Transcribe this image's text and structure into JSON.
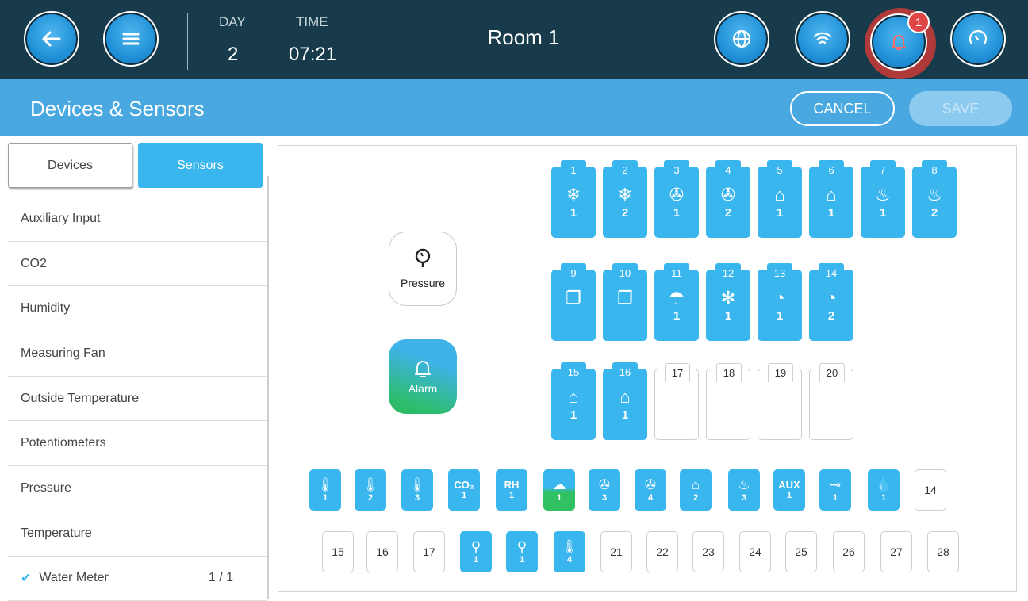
{
  "header": {
    "day_label": "DAY",
    "day_value": "2",
    "time_label": "TIME",
    "time_value": "07:21",
    "room": "Room 1",
    "alarm_count": "1",
    "icons": [
      "back-arrow-icon",
      "menu-icon",
      "globe-icon",
      "wifi-icon",
      "bell-icon",
      "gauge-icon"
    ]
  },
  "titlebar": {
    "title": "Devices & Sensors",
    "cancel": "CANCEL",
    "save": "SAVE"
  },
  "tabs": {
    "devices": "Devices",
    "sensors": "Sensors",
    "active": "Sensors"
  },
  "sensor_list": [
    {
      "label": "Auxiliary Input"
    },
    {
      "label": "CO2"
    },
    {
      "label": "Humidity"
    },
    {
      "label": "Measuring Fan"
    },
    {
      "label": "Outside Temperature"
    },
    {
      "label": "Potentiometers"
    },
    {
      "label": "Pressure"
    },
    {
      "label": "Temperature"
    },
    {
      "label": "Water Meter",
      "count": "1 / 1",
      "checked": true,
      "check": "✔"
    }
  ],
  "panel_buttons": {
    "pressure": "Pressure",
    "alarm": "Alarm"
  },
  "relay_slots": [
    {
      "num": "1",
      "glyph": "❄",
      "sub": "1",
      "on": true
    },
    {
      "num": "2",
      "glyph": "❄",
      "sub": "2",
      "on": true
    },
    {
      "num": "3",
      "glyph": "✇",
      "sub": "1",
      "on": true
    },
    {
      "num": "4",
      "glyph": "✇",
      "sub": "2",
      "on": true
    },
    {
      "num": "5",
      "glyph": "⌂",
      "sub": "1",
      "on": true
    },
    {
      "num": "6",
      "glyph": "⌂",
      "sub": "1",
      "on": true
    },
    {
      "num": "7",
      "glyph": "♨",
      "sub": "1",
      "on": true
    },
    {
      "num": "8",
      "glyph": "♨",
      "sub": "2",
      "on": true
    },
    {
      "num": "9",
      "glyph": "❐",
      "sub": "",
      "on": true
    },
    {
      "num": "10",
      "glyph": "❐",
      "sub": "",
      "on": true
    },
    {
      "num": "11",
      "glyph": "☂",
      "sub": "1",
      "on": true
    },
    {
      "num": "12",
      "glyph": "✻",
      "sub": "1",
      "on": true
    },
    {
      "num": "13",
      "glyph": "◔",
      "sub": "1",
      "on": true
    },
    {
      "num": "14",
      "glyph": "◔",
      "sub": "2",
      "on": true
    },
    {
      "num": "15",
      "glyph": "⌂",
      "sub": "1",
      "on": true
    },
    {
      "num": "16",
      "glyph": "⌂",
      "sub": "1",
      "on": true
    },
    {
      "num": "17",
      "glyph": "",
      "sub": "",
      "on": false
    },
    {
      "num": "18",
      "glyph": "",
      "sub": "",
      "on": false
    },
    {
      "num": "19",
      "glyph": "",
      "sub": "",
      "on": false
    },
    {
      "num": "20",
      "glyph": "",
      "sub": "",
      "on": false
    }
  ],
  "analog_row1": [
    {
      "glyph": "🌡",
      "sub": "1",
      "on": true
    },
    {
      "glyph": "🌡",
      "sub": "2",
      "on": true
    },
    {
      "glyph": "🌡",
      "sub": "3",
      "on": true
    },
    {
      "text": "CO₂",
      "sub": "1",
      "on": true
    },
    {
      "text": "RH",
      "sub": "1",
      "on": true
    },
    {
      "glyph": "☁",
      "sub": "1",
      "on": true,
      "weather": true
    },
    {
      "glyph": "✇",
      "sub": "3",
      "on": true
    },
    {
      "glyph": "✇",
      "sub": "4",
      "on": true
    },
    {
      "glyph": "⌂",
      "sub": "2",
      "on": true
    },
    {
      "glyph": "♨",
      "sub": "3",
      "on": true
    },
    {
      "text": "AUX",
      "sub": "1",
      "on": true
    },
    {
      "glyph": "⊸",
      "sub": "1",
      "on": true
    },
    {
      "glyph": "💧",
      "sub": "1",
      "on": true
    },
    {
      "text": "14",
      "on": false
    }
  ],
  "analog_row2": [
    {
      "text": "15",
      "on": false
    },
    {
      "text": "16",
      "on": false
    },
    {
      "text": "17",
      "on": false
    },
    {
      "glyph": "⚲",
      "sub": "1",
      "on": true
    },
    {
      "glyph": "⚲",
      "sub": "1",
      "on": true
    },
    {
      "glyph": "🌡",
      "sub": "4",
      "on": true
    },
    {
      "text": "21",
      "on": false
    },
    {
      "text": "22",
      "on": false
    },
    {
      "text": "23",
      "on": false
    },
    {
      "text": "24",
      "on": false
    },
    {
      "text": "25",
      "on": false
    },
    {
      "text": "26",
      "on": false
    },
    {
      "text": "27",
      "on": false
    },
    {
      "text": "28",
      "on": false
    }
  ]
}
